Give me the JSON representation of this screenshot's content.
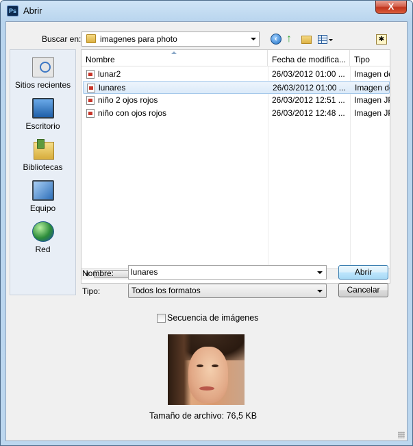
{
  "window": {
    "title": "Abrir",
    "app_icon": "Ps",
    "close_label": "X"
  },
  "toolbar": {
    "look_in_label": "Buscar en:",
    "look_in_value": "imagenes para photo",
    "icons": [
      "back-icon",
      "up-folder-icon",
      "new-folder-icon",
      "view-menu-icon",
      "extra-icon"
    ]
  },
  "places": [
    {
      "label": "Sitios recientes",
      "icon": "recent-places-icon"
    },
    {
      "label": "Escritorio",
      "icon": "desktop-icon"
    },
    {
      "label": "Bibliotecas",
      "icon": "libraries-icon"
    },
    {
      "label": "Equipo",
      "icon": "computer-icon"
    },
    {
      "label": "Red",
      "icon": "network-icon"
    }
  ],
  "file_list": {
    "columns": [
      "Nombre",
      "Fecha de modifica...",
      "Tipo"
    ],
    "rows": [
      {
        "name": "lunar2",
        "date": "26/03/2012 01:00 ...",
        "type": "Imagen de"
      },
      {
        "name": "lunares",
        "date": "26/03/2012 01:00 ...",
        "type": "Imagen de",
        "selected": true
      },
      {
        "name": "niño 2 ojos rojos",
        "date": "26/03/2012 12:51 ...",
        "type": "Imagen JP"
      },
      {
        "name": "niño con ojos rojos",
        "date": "26/03/2012 12:48 ...",
        "type": "Imagen JP"
      }
    ]
  },
  "form": {
    "name_label": "Nombre:",
    "name_value": "lunares",
    "type_label": "Tipo:",
    "type_value": "Todos los formatos",
    "open_button": "Abrir",
    "cancel_button": "Cancelar"
  },
  "options": {
    "sequence_label": "Secuencia de imágenes",
    "sequence_checked": false
  },
  "preview": {
    "file_size": "Tamaño de archivo: 76,5 KB"
  },
  "colors": {
    "title_gradient_top": "#cfe4f6",
    "selection": "#dbeaf9",
    "primary_button": "#a7d9f5",
    "close_button": "#c0341c"
  }
}
